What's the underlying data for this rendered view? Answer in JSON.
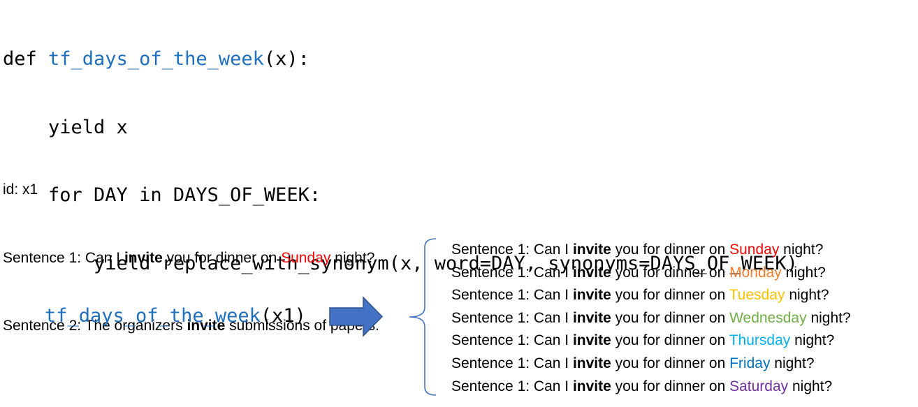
{
  "code": {
    "line1": {
      "kw": "def ",
      "fn": "tf_days_of_the_week",
      "rest": "(x):"
    },
    "line2": "    yield x",
    "line3": "    for DAY in DAYS_OF_WEEK:",
    "line4": "        yield replace_with_synonym(x, word=DAY, synonyms=DAYS_OF_WEEK)"
  },
  "example": {
    "id_line": "id: x1",
    "sentence1": {
      "prefix": "Sentence 1: Can I ",
      "keyword": "invite",
      "middle": " you for dinner on ",
      "day": "Sunday",
      "suffix": " night?",
      "day_color": "#ff0000"
    },
    "sentence2": {
      "prefix": "Sentence 2: The organizers ",
      "keyword": "invite",
      "suffix": " submissions of papers."
    }
  },
  "call": {
    "fn": "tf_days_of_the_week",
    "args": "(x1)"
  },
  "arrow": {
    "color": "#4472c4",
    "border": "#2f528f"
  },
  "brace": {
    "color": "#4472c4"
  },
  "outputs": {
    "prefix": "Sentence 1: Can I ",
    "keyword": "invite",
    "middle": " you for dinner on ",
    "suffix": " night?",
    "days": [
      {
        "name": "Sunday",
        "color": "#ff0000"
      },
      {
        "name": "Monday",
        "color": "#ed7d31"
      },
      {
        "name": "Tuesday",
        "color": "#ffc000"
      },
      {
        "name": "Wednesday",
        "color": "#70ad47"
      },
      {
        "name": "Thursday",
        "color": "#00b0f0"
      },
      {
        "name": "Friday",
        "color": "#0070c0"
      },
      {
        "name": "Saturday",
        "color": "#7030a0"
      }
    ]
  }
}
